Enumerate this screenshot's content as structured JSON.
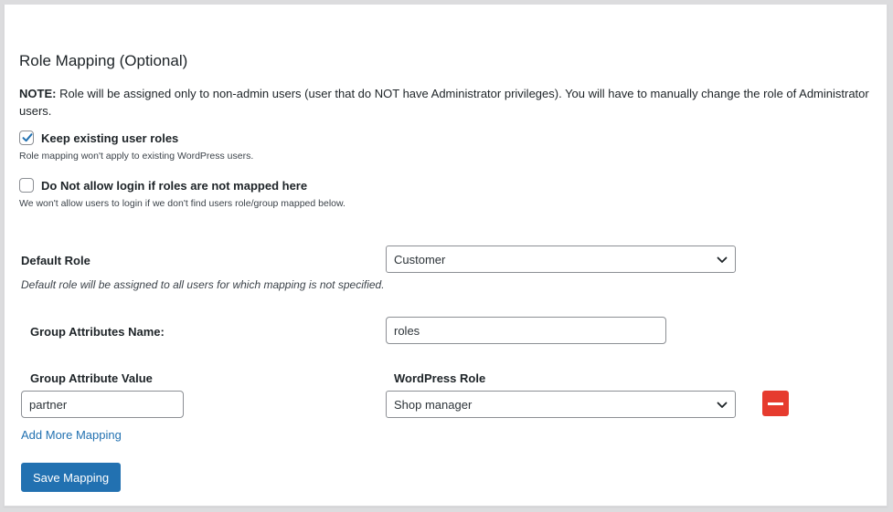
{
  "section": {
    "title": "Role Mapping (Optional)",
    "note_label": "NOTE:",
    "note_text": " Role will be assigned only to non-admin users (user that do NOT have Administrator privileges). You will have to manually change the role of Administrator users."
  },
  "options": {
    "keep_roles": {
      "label": "Keep existing user roles",
      "checked": true,
      "help": "Role mapping won't apply to existing WordPress users."
    },
    "deny_login": {
      "label": "Do Not allow login if roles are not mapped here",
      "checked": false,
      "help": "We won't allow users to login if we don't find users role/group mapped below."
    }
  },
  "default_role": {
    "label": "Default Role",
    "selected": "Customer",
    "help": "Default role will be assigned to all users for which mapping is not specified."
  },
  "group_attr": {
    "label": "Group Attributes Name:",
    "value": "roles"
  },
  "mapping": {
    "col_value_label": "Group Attribute Value",
    "col_role_label": "WordPress Role",
    "rows": [
      {
        "attribute_value": "partner",
        "wp_role": "Shop manager"
      }
    ]
  },
  "actions": {
    "add_more": "Add More Mapping",
    "save": "Save Mapping"
  },
  "colors": {
    "primary": "#2271b1",
    "danger": "#e63b2e",
    "checkmark": "#2271b1"
  }
}
